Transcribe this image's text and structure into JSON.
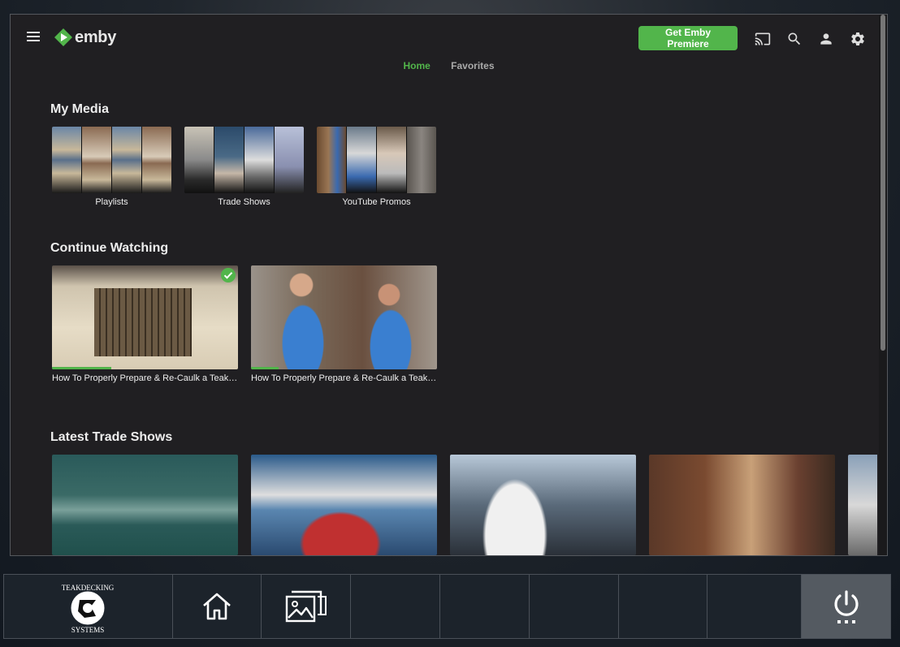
{
  "app": {
    "logo_text": "emby",
    "premiere_button": "Get Emby Premiere",
    "icons": [
      "menu-icon",
      "cast-icon",
      "search-icon",
      "user-icon",
      "settings-icon"
    ]
  },
  "tabs": [
    {
      "label": "Home",
      "active": true
    },
    {
      "label": "Favorites",
      "active": false
    }
  ],
  "sections": {
    "my_media": {
      "title": "My Media",
      "items": [
        {
          "label": "Playlists"
        },
        {
          "label": "Trade Shows"
        },
        {
          "label": "YouTube Promos"
        }
      ]
    },
    "continue_watching": {
      "title": "Continue Watching",
      "items": [
        {
          "label": "How To Properly Prepare & Re-Caulk a Teak Deck",
          "progress": 0.32,
          "watched": true
        },
        {
          "label": "How To Properly Prepare & Re-Caulk a Teak Deck",
          "progress": 0.15,
          "watched": false
        }
      ]
    },
    "latest_trade_shows": {
      "title": "Latest Trade Shows"
    }
  },
  "taskbar": {
    "brand_lines": [
      "TEAKDECKING",
      "SYSTEMS"
    ],
    "icons": [
      "teakdecking-logo",
      "home-icon",
      "gallery-icon",
      "power-icon"
    ]
  },
  "colors": {
    "accent": "#52b54b",
    "window_bg": "#201f22",
    "taskbar_bg": "#1c232b",
    "power_bg": "#545a61"
  }
}
